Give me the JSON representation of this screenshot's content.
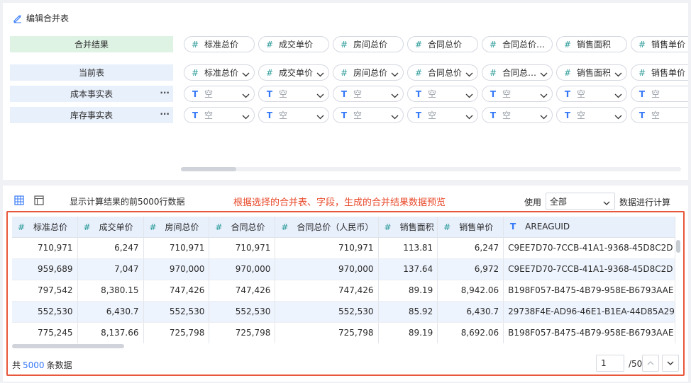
{
  "header": {
    "edit_label": "编辑合并表"
  },
  "rows": [
    {
      "label": "合并结果",
      "style": "green",
      "has_more": false,
      "has_chevron": false,
      "cells": [
        {
          "type": "number",
          "text": "标准总价"
        },
        {
          "type": "number",
          "text": "成交单价"
        },
        {
          "type": "number",
          "text": "房间总价"
        },
        {
          "type": "number",
          "text": "合同总价"
        },
        {
          "type": "number",
          "text": "合同总价（…"
        },
        {
          "type": "number",
          "text": "销售面积"
        },
        {
          "type": "number",
          "text": "销售单价"
        }
      ]
    },
    {
      "label": "当前表",
      "style": "blue",
      "has_more": false,
      "has_chevron": true,
      "cells": [
        {
          "type": "number",
          "text": "标准总价"
        },
        {
          "type": "number",
          "text": "成交单价"
        },
        {
          "type": "number",
          "text": "房间总价"
        },
        {
          "type": "number",
          "text": "合同总价"
        },
        {
          "type": "number",
          "text": "合同总…"
        },
        {
          "type": "number",
          "text": "销售面积"
        },
        {
          "type": "number",
          "text": "销售单价"
        }
      ]
    },
    {
      "label": "成本事实表",
      "style": "blue",
      "has_more": true,
      "has_chevron": true,
      "cells": [
        {
          "type": "text",
          "text": "空"
        },
        {
          "type": "text",
          "text": "空"
        },
        {
          "type": "text",
          "text": "空"
        },
        {
          "type": "text",
          "text": "空"
        },
        {
          "type": "text",
          "text": "空"
        },
        {
          "type": "text",
          "text": "空"
        },
        {
          "type": "text",
          "text": "空"
        }
      ]
    },
    {
      "label": "库存事实表",
      "style": "blue",
      "has_more": true,
      "has_chevron": true,
      "cells": [
        {
          "type": "text",
          "text": "空"
        },
        {
          "type": "text",
          "text": "空"
        },
        {
          "type": "text",
          "text": "空"
        },
        {
          "type": "text",
          "text": "空"
        },
        {
          "type": "text",
          "text": "空"
        },
        {
          "type": "text",
          "text": "空"
        },
        {
          "type": "text",
          "text": "空"
        }
      ]
    }
  ],
  "more_glyph": "···",
  "type_icons": {
    "number": "#",
    "text": "T"
  },
  "preview": {
    "label": "显示计算结果的前5000行数据",
    "annotation": "根据选择的合并表、字段，生成的合并结果数据预览",
    "use_label": "使用",
    "use_value": "全部",
    "use_after": "数据进行计算"
  },
  "table": {
    "columns": [
      {
        "type": "number",
        "name": "标准总价"
      },
      {
        "type": "number",
        "name": "成交单价"
      },
      {
        "type": "number",
        "name": "房间总价"
      },
      {
        "type": "number",
        "name": "合同总价"
      },
      {
        "type": "number",
        "name": "合同总价（人民币）"
      },
      {
        "type": "number",
        "name": "销售面积"
      },
      {
        "type": "number",
        "name": "销售单价"
      },
      {
        "type": "text",
        "name": "AREAGUID"
      }
    ],
    "rows": [
      [
        "710,971",
        "6,247",
        "710,971",
        "710,971",
        "710,971",
        "113.81",
        "6,247",
        "C9EE7D70-7CCB-41A1-9368-45D8C2D"
      ],
      [
        "959,689",
        "7,047",
        "970,000",
        "970,000",
        "970,000",
        "137.64",
        "6,972",
        "C9EE7D70-7CCB-41A1-9368-45D8C2D"
      ],
      [
        "797,542",
        "8,380.15",
        "747,426",
        "747,426",
        "747,426",
        "89.19",
        "8,942.06",
        "B198F057-B475-4B79-958E-B6793AAE"
      ],
      [
        "552,530",
        "6,430.7",
        "552,530",
        "552,530",
        "552,530",
        "85.92",
        "6,430.7",
        "29738F4E-AD96-46E1-B1EA-44D85A29"
      ],
      [
        "775,245",
        "8,137.66",
        "725,798",
        "725,798",
        "725,798",
        "89.19",
        "8,692.06",
        "B198F057-B475-4B79-958E-B6793AAE"
      ]
    ]
  },
  "footer": {
    "prefix": "共",
    "count": "5000",
    "suffix": "条数据",
    "page": "1",
    "page_total": "/50"
  },
  "colors": {
    "accent": "#3478f6",
    "number_icon": "#2e9c9a",
    "annotation": "#e8492a",
    "green_label_bg": "#dff3e4",
    "blue_label_bg": "#e8f0fc"
  }
}
